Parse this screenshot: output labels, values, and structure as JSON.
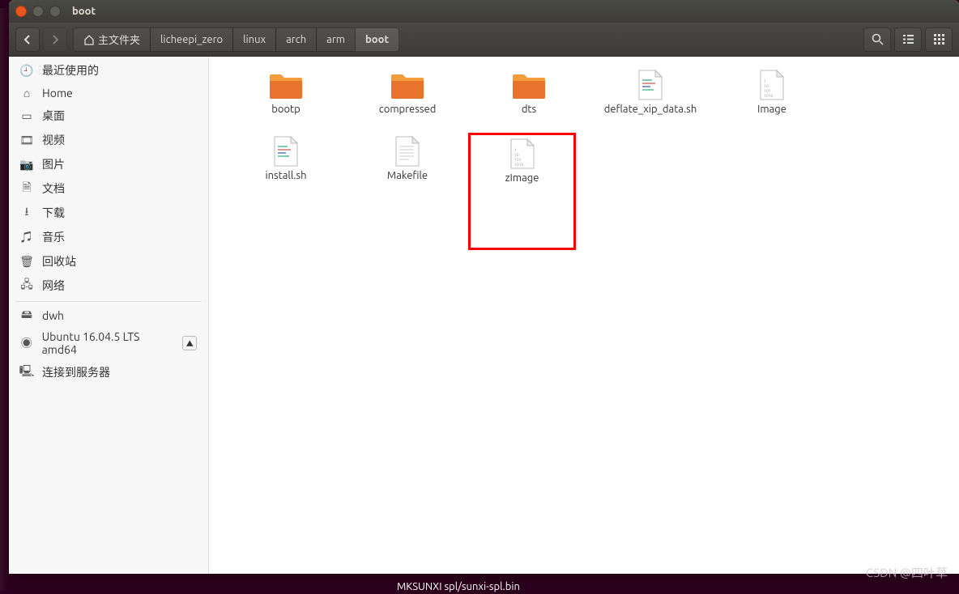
{
  "window": {
    "title": "boot"
  },
  "breadcrumb": {
    "home": "主文件夹",
    "items": [
      "licheepi_zero",
      "linux",
      "arch",
      "arm",
      "boot"
    ],
    "active": "boot"
  },
  "sidebar": {
    "recent": "最近使用的",
    "home": "Home",
    "desktop": "桌面",
    "videos": "视频",
    "pictures": "图片",
    "documents": "文档",
    "downloads": "下载",
    "music": "音乐",
    "trash": "回收站",
    "network": "网络",
    "user": "dwh",
    "os": "Ubuntu 16.04.5 LTS amd64",
    "connect": "连接到服务器"
  },
  "files": [
    {
      "name": "bootp",
      "type": "folder"
    },
    {
      "name": "compressed",
      "type": "folder"
    },
    {
      "name": "dts",
      "type": "folder"
    },
    {
      "name": "deflate_xip_data.sh",
      "type": "script"
    },
    {
      "name": "Image",
      "type": "binary"
    },
    {
      "name": "install.sh",
      "type": "script"
    },
    {
      "name": "Makefile",
      "type": "text"
    },
    {
      "name": "zImage",
      "type": "binary",
      "highlighted": true
    }
  ],
  "terminal": {
    "line": "MKSUNXI spl/sunxi-spl.bin"
  },
  "watermark": "CSDN @四叶草"
}
